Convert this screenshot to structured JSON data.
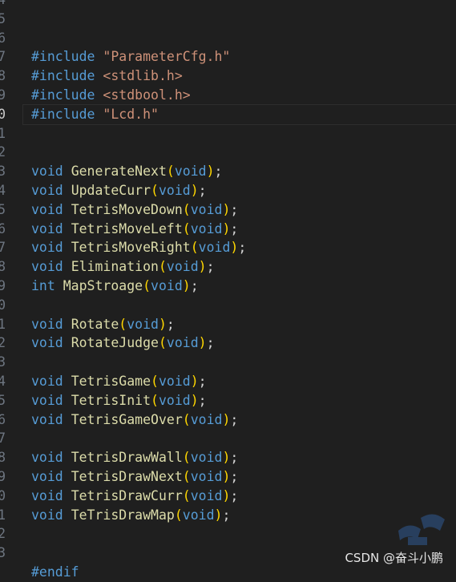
{
  "editor": {
    "lines": [
      {
        "n": "4",
        "tokens": []
      },
      {
        "n": "5",
        "tokens": []
      },
      {
        "n": "6",
        "tokens": []
      },
      {
        "n": "7",
        "tokens": [
          {
            "t": "#include",
            "c": "kw-dir"
          },
          {
            "t": " ",
            "c": "sp"
          },
          {
            "t": "\"ParameterCfg.h\"",
            "c": "str"
          }
        ]
      },
      {
        "n": "8",
        "tokens": [
          {
            "t": "#include",
            "c": "kw-dir"
          },
          {
            "t": " ",
            "c": "sp"
          },
          {
            "t": "<stdlib.h>",
            "c": "str"
          }
        ]
      },
      {
        "n": "9",
        "tokens": [
          {
            "t": "#include",
            "c": "kw-dir"
          },
          {
            "t": " ",
            "c": "sp"
          },
          {
            "t": "<stdbool.h>",
            "c": "str"
          }
        ]
      },
      {
        "n": "0",
        "active": true,
        "tokens": [
          {
            "t": "#include",
            "c": "kw-dir"
          },
          {
            "t": " ",
            "c": "sp"
          },
          {
            "t": "\"Lcd.h\"",
            "c": "str"
          }
        ]
      },
      {
        "n": "1",
        "tokens": []
      },
      {
        "n": "2",
        "tokens": []
      },
      {
        "n": "3",
        "tokens": [
          {
            "t": "void",
            "c": "kw-type"
          },
          {
            "t": " ",
            "c": "sp"
          },
          {
            "t": "GenerateNext",
            "c": "fn"
          },
          {
            "t": "(",
            "c": "paren"
          },
          {
            "t": "void",
            "c": "kw-type"
          },
          {
            "t": ")",
            "c": "paren"
          },
          {
            "t": ";",
            "c": "punct"
          }
        ]
      },
      {
        "n": "4",
        "tokens": [
          {
            "t": "void",
            "c": "kw-type"
          },
          {
            "t": " ",
            "c": "sp"
          },
          {
            "t": "UpdateCurr",
            "c": "fn"
          },
          {
            "t": "(",
            "c": "paren"
          },
          {
            "t": "void",
            "c": "kw-type"
          },
          {
            "t": ")",
            "c": "paren"
          },
          {
            "t": ";",
            "c": "punct"
          }
        ]
      },
      {
        "n": "5",
        "tokens": [
          {
            "t": "void",
            "c": "kw-type"
          },
          {
            "t": " ",
            "c": "sp"
          },
          {
            "t": "TetrisMoveDown",
            "c": "fn"
          },
          {
            "t": "(",
            "c": "paren"
          },
          {
            "t": "void",
            "c": "kw-type"
          },
          {
            "t": ")",
            "c": "paren"
          },
          {
            "t": ";",
            "c": "punct"
          }
        ]
      },
      {
        "n": "6",
        "tokens": [
          {
            "t": "void",
            "c": "kw-type"
          },
          {
            "t": " ",
            "c": "sp"
          },
          {
            "t": "TetrisMoveLeft",
            "c": "fn"
          },
          {
            "t": "(",
            "c": "paren"
          },
          {
            "t": "void",
            "c": "kw-type"
          },
          {
            "t": ")",
            "c": "paren"
          },
          {
            "t": ";",
            "c": "punct"
          }
        ]
      },
      {
        "n": "7",
        "tokens": [
          {
            "t": "void",
            "c": "kw-type"
          },
          {
            "t": " ",
            "c": "sp"
          },
          {
            "t": "TetrisMoveRight",
            "c": "fn"
          },
          {
            "t": "(",
            "c": "paren"
          },
          {
            "t": "void",
            "c": "kw-type"
          },
          {
            "t": ")",
            "c": "paren"
          },
          {
            "t": ";",
            "c": "punct"
          }
        ]
      },
      {
        "n": "8",
        "tokens": [
          {
            "t": "void",
            "c": "kw-type"
          },
          {
            "t": " ",
            "c": "sp"
          },
          {
            "t": "Elimination",
            "c": "fn"
          },
          {
            "t": "(",
            "c": "paren"
          },
          {
            "t": "void",
            "c": "kw-type"
          },
          {
            "t": ")",
            "c": "paren"
          },
          {
            "t": ";",
            "c": "punct"
          }
        ]
      },
      {
        "n": "9",
        "tokens": [
          {
            "t": "int",
            "c": "kw-type"
          },
          {
            "t": " ",
            "c": "sp"
          },
          {
            "t": "MapStroage",
            "c": "fn"
          },
          {
            "t": "(",
            "c": "paren"
          },
          {
            "t": "void",
            "c": "kw-type"
          },
          {
            "t": ")",
            "c": "paren"
          },
          {
            "t": ";",
            "c": "punct"
          }
        ]
      },
      {
        "n": "0",
        "tokens": []
      },
      {
        "n": "1",
        "tokens": [
          {
            "t": "void",
            "c": "kw-type"
          },
          {
            "t": " ",
            "c": "sp"
          },
          {
            "t": "Rotate",
            "c": "fn"
          },
          {
            "t": "(",
            "c": "paren"
          },
          {
            "t": "void",
            "c": "kw-type"
          },
          {
            "t": ")",
            "c": "paren"
          },
          {
            "t": ";",
            "c": "punct"
          }
        ]
      },
      {
        "n": "2",
        "tokens": [
          {
            "t": "void",
            "c": "kw-type"
          },
          {
            "t": " ",
            "c": "sp"
          },
          {
            "t": "RotateJudge",
            "c": "fn"
          },
          {
            "t": "(",
            "c": "paren"
          },
          {
            "t": "void",
            "c": "kw-type"
          },
          {
            "t": ")",
            "c": "paren"
          },
          {
            "t": ";",
            "c": "punct"
          }
        ]
      },
      {
        "n": "3",
        "tokens": []
      },
      {
        "n": "4",
        "tokens": [
          {
            "t": "void",
            "c": "kw-type"
          },
          {
            "t": " ",
            "c": "sp"
          },
          {
            "t": "TetrisGame",
            "c": "fn"
          },
          {
            "t": "(",
            "c": "paren"
          },
          {
            "t": "void",
            "c": "kw-type"
          },
          {
            "t": ")",
            "c": "paren"
          },
          {
            "t": ";",
            "c": "punct"
          }
        ]
      },
      {
        "n": "5",
        "tokens": [
          {
            "t": "void",
            "c": "kw-type"
          },
          {
            "t": " ",
            "c": "sp"
          },
          {
            "t": "TetrisInit",
            "c": "fn"
          },
          {
            "t": "(",
            "c": "paren"
          },
          {
            "t": "void",
            "c": "kw-type"
          },
          {
            "t": ")",
            "c": "paren"
          },
          {
            "t": ";",
            "c": "punct"
          }
        ]
      },
      {
        "n": "6",
        "tokens": [
          {
            "t": "void",
            "c": "kw-type"
          },
          {
            "t": " ",
            "c": "sp"
          },
          {
            "t": "TetrisGameOver",
            "c": "fn"
          },
          {
            "t": "(",
            "c": "paren"
          },
          {
            "t": "void",
            "c": "kw-type"
          },
          {
            "t": ")",
            "c": "paren"
          },
          {
            "t": ";",
            "c": "punct"
          }
        ]
      },
      {
        "n": "7",
        "tokens": []
      },
      {
        "n": "8",
        "tokens": [
          {
            "t": "void",
            "c": "kw-type"
          },
          {
            "t": " ",
            "c": "sp"
          },
          {
            "t": "TetrisDrawWall",
            "c": "fn"
          },
          {
            "t": "(",
            "c": "paren"
          },
          {
            "t": "void",
            "c": "kw-type"
          },
          {
            "t": ")",
            "c": "paren"
          },
          {
            "t": ";",
            "c": "punct"
          }
        ]
      },
      {
        "n": "9",
        "tokens": [
          {
            "t": "void",
            "c": "kw-type"
          },
          {
            "t": " ",
            "c": "sp"
          },
          {
            "t": "TetrisDrawNext",
            "c": "fn"
          },
          {
            "t": "(",
            "c": "paren"
          },
          {
            "t": "void",
            "c": "kw-type"
          },
          {
            "t": ")",
            "c": "paren"
          },
          {
            "t": ";",
            "c": "punct"
          }
        ]
      },
      {
        "n": "0",
        "tokens": [
          {
            "t": "void",
            "c": "kw-type"
          },
          {
            "t": " ",
            "c": "sp"
          },
          {
            "t": "TetrisDrawCurr",
            "c": "fn"
          },
          {
            "t": "(",
            "c": "paren"
          },
          {
            "t": "void",
            "c": "kw-type"
          },
          {
            "t": ")",
            "c": "paren"
          },
          {
            "t": ";",
            "c": "punct"
          }
        ]
      },
      {
        "n": "1",
        "tokens": [
          {
            "t": "void",
            "c": "kw-type"
          },
          {
            "t": " ",
            "c": "sp"
          },
          {
            "t": "TeTrisDrawMap",
            "c": "fn"
          },
          {
            "t": "(",
            "c": "paren"
          },
          {
            "t": "void",
            "c": "kw-type"
          },
          {
            "t": ")",
            "c": "paren"
          },
          {
            "t": ";",
            "c": "punct"
          }
        ]
      },
      {
        "n": "2",
        "tokens": []
      },
      {
        "n": "3",
        "tokens": []
      },
      {
        "n": "",
        "tokens": [
          {
            "t": "#endif",
            "c": "kw-dir"
          }
        ]
      }
    ]
  },
  "watermark": {
    "text": "CSDN @奋斗小鹏"
  },
  "colors": {
    "background": "#1f1f1f",
    "keyword": "#569cd6",
    "string": "#ce9178",
    "function": "#dcdcaa",
    "bracket": "#ffd700"
  }
}
